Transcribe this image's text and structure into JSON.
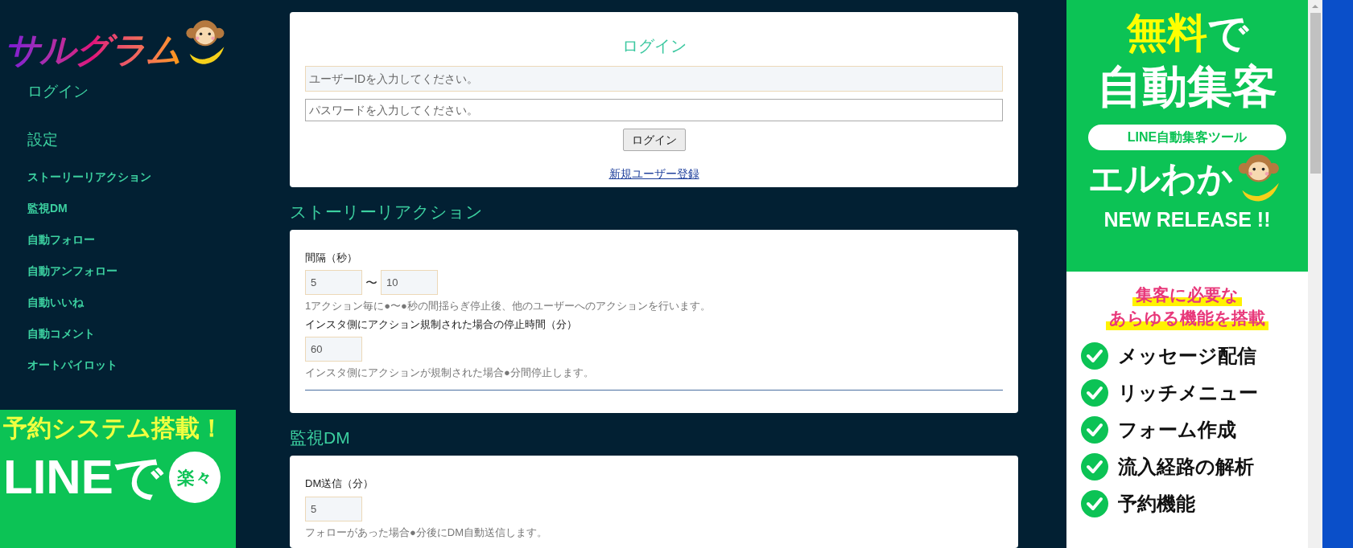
{
  "sidebar": {
    "logo": "サルグラム",
    "sections": [
      {
        "label": "ログイン"
      },
      {
        "label": "設定"
      }
    ],
    "items": [
      {
        "label": "ストーリーリアクション"
      },
      {
        "label": "監視DM"
      },
      {
        "label": "自動フォロー"
      },
      {
        "label": "自動アンフォロー"
      },
      {
        "label": "自動いいね"
      },
      {
        "label": "自動コメント"
      },
      {
        "label": "オートパイロット"
      }
    ],
    "ad": {
      "headline": "予約システム搭載！",
      "big": "LINEで",
      "badge": "楽々"
    }
  },
  "login": {
    "title": "ログイン",
    "user_field": {
      "placeholder": "ユーザーIDを入力してください。"
    },
    "password_field": {
      "placeholder": "パスワードを入力してください。"
    },
    "button": "ログイン",
    "register_link": "新規ユーザー登録"
  },
  "sections": [
    {
      "title": "ストーリーリアクション",
      "fields": [
        {
          "kind": "range",
          "label": "間隔（秒）",
          "values": [
            "5",
            "10"
          ],
          "separator": "〜",
          "hint": "1アクション毎に●〜●秒の間揺らぎ停止後、他のユーザーへのアクションを行います。"
        },
        {
          "kind": "single",
          "label": "インスタ側にアクション規制された場合の停止時間（分）",
          "values": [
            "60"
          ],
          "hint": "インスタ側にアクションが規制された場合●分間停止します。"
        }
      ],
      "divider": true
    },
    {
      "title": "監視DM",
      "fields": [
        {
          "kind": "single",
          "label": "DM送信（分）",
          "values": [
            "5"
          ],
          "hint": "フォローがあった場合●分後にDM自動送信します。"
        }
      ],
      "divider": false
    }
  ],
  "right_ad": {
    "line1_highlight": "無料",
    "line1_rest": "で",
    "line2": "自動集客",
    "pill": "LINE自動集客ツール",
    "brand": "エルわか",
    "release": "NEW RELEASE !!",
    "pitch": [
      "集客に必要な",
      "あらゆる機能を搭載"
    ],
    "features": [
      "メッセージ配信",
      "リッチメニュー",
      "フォーム作成",
      "流入経路の解析",
      "予約機能"
    ]
  }
}
